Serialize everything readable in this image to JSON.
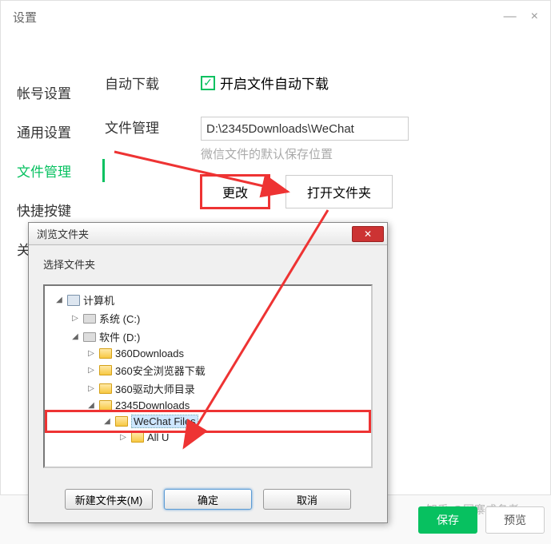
{
  "settings": {
    "title": "设置",
    "sidebar": [
      "帐号设置",
      "通用设置",
      "文件管理",
      "快捷按键",
      "关于微信"
    ],
    "active_index": 2,
    "auto_download": {
      "label": "自动下载",
      "checkbox": "开启文件自动下载"
    },
    "file_mgmt": {
      "label": "文件管理",
      "path": "D:\\2345Downloads\\WeChat",
      "hint": "微信文件的默认保存位置",
      "change": "更改",
      "open": "打开文件夹"
    }
  },
  "browse": {
    "title": "浏览文件夹",
    "prompt": "选择文件夹",
    "tree": [
      {
        "label": "计算机",
        "icon": "computer",
        "depth": 0,
        "expanded": true
      },
      {
        "label": "系统 (C:)",
        "icon": "drive",
        "depth": 1,
        "expanded": false
      },
      {
        "label": "软件 (D:)",
        "icon": "drive",
        "depth": 1,
        "expanded": true
      },
      {
        "label": "360Downloads",
        "icon": "folder",
        "depth": 2,
        "expanded": false
      },
      {
        "label": "360安全浏览器下载",
        "icon": "folder",
        "depth": 2,
        "expanded": false
      },
      {
        "label": "360驱动大师目录",
        "icon": "folder",
        "depth": 2,
        "expanded": false
      },
      {
        "label": "2345Downloads",
        "icon": "folder",
        "depth": 2,
        "expanded": true
      },
      {
        "label": "WeChat Files",
        "icon": "folder",
        "depth": 3,
        "expanded": true,
        "selected": true,
        "red_box": true
      },
      {
        "label": "All U",
        "icon": "folder",
        "depth": 4,
        "expanded": false,
        "partial": true
      }
    ],
    "new_folder": "新建文件夹(M)",
    "ok": "确定",
    "cancel": "取消"
  },
  "footer": {
    "save": "保存",
    "preview": "预览"
  },
  "watermark": "知乎 @网寨成名者"
}
